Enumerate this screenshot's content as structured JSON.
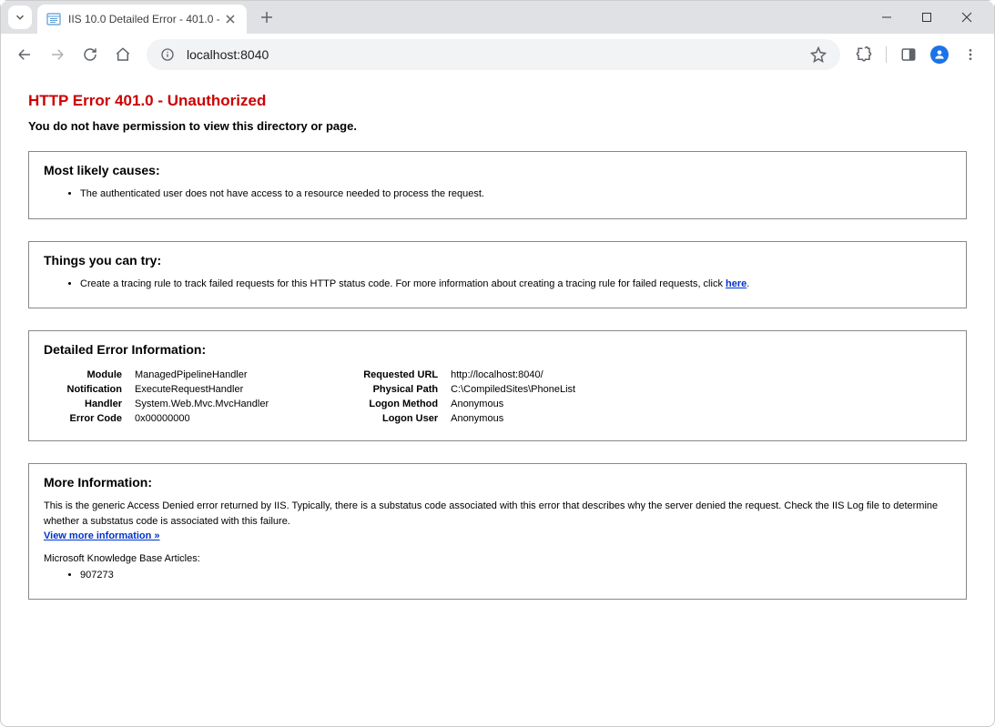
{
  "browser": {
    "tab_title": "IIS 10.0 Detailed Error - 401.0 -",
    "url": "localhost:8040"
  },
  "page": {
    "title": "HTTP Error 401.0 - Unauthorized",
    "subtitle": "You do not have permission to view this directory or page.",
    "causes": {
      "heading": "Most likely causes:",
      "items": [
        "The authenticated user does not have access to a resource needed to process the request."
      ]
    },
    "try": {
      "heading": "Things you can try:",
      "item_prefix": "Create a tracing rule to track failed requests for this HTTP status code. For more information about creating a tracing rule for failed requests, click ",
      "link_text": "here",
      "item_suffix": "."
    },
    "detail": {
      "heading": "Detailed Error Information:",
      "left": {
        "module_label": "Module",
        "module_value": "ManagedPipelineHandler",
        "notification_label": "Notification",
        "notification_value": "ExecuteRequestHandler",
        "handler_label": "Handler",
        "handler_value": "System.Web.Mvc.MvcHandler",
        "error_code_label": "Error Code",
        "error_code_value": "0x00000000"
      },
      "right": {
        "requested_url_label": "Requested URL",
        "requested_url_value": "http://localhost:8040/",
        "physical_path_label": "Physical Path",
        "physical_path_value": "C:\\CompiledSites\\PhoneList",
        "logon_method_label": "Logon Method",
        "logon_method_value": "Anonymous",
        "logon_user_label": "Logon User",
        "logon_user_value": "Anonymous"
      }
    },
    "more": {
      "heading": "More Information:",
      "text": "This is the generic Access Denied error returned by IIS. Typically, there is a substatus code associated with this error that describes why the server denied the request. Check the IIS Log file to determine whether a substatus code is associated with this failure.",
      "link_text": "View more information »",
      "kb_label": "Microsoft Knowledge Base Articles:",
      "kb_items": [
        "907273"
      ]
    }
  }
}
